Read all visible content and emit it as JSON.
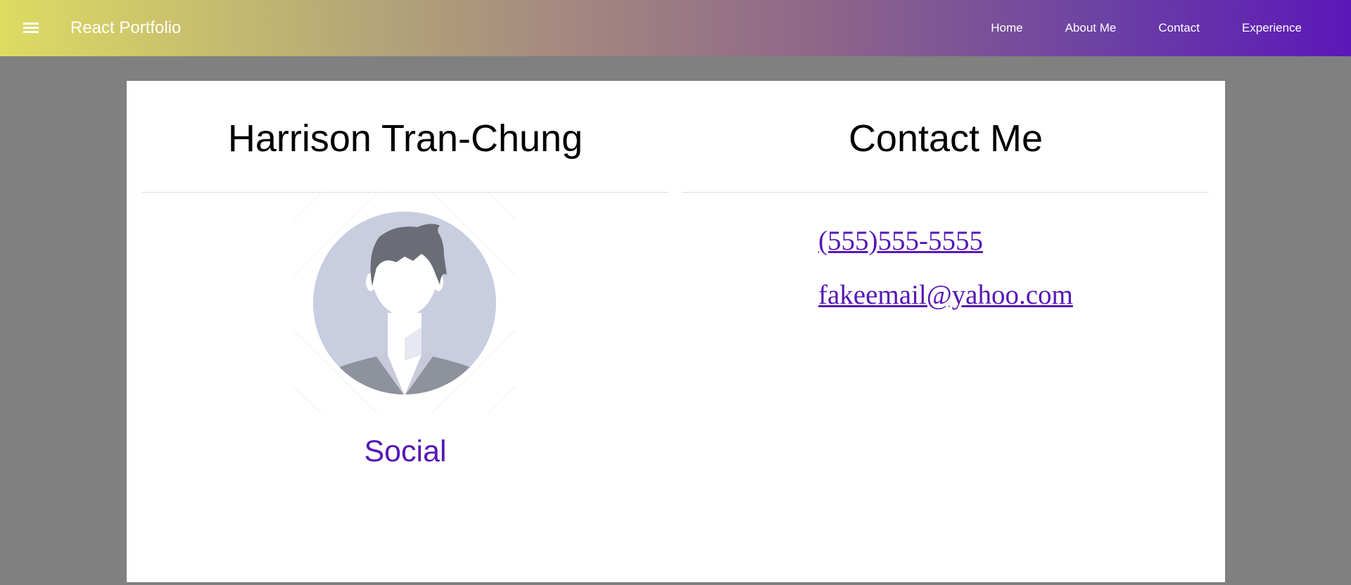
{
  "header": {
    "menu_icon": "hamburger-menu-icon",
    "brand": "React Portfolio",
    "nav": [
      {
        "label": "Home"
      },
      {
        "label": "About Me"
      },
      {
        "label": "Contact"
      },
      {
        "label": "Experience"
      }
    ]
  },
  "profile": {
    "name": "Harrison Tran-Chung",
    "avatar_icon": "default-user-avatar",
    "social_label": "Social"
  },
  "contact": {
    "title": "Contact Me",
    "phone": "(555)555-5555",
    "email": "fakeemail@yahoo.com"
  },
  "colors": {
    "link": "#5617b6",
    "header_gradient_start": "#dedb62",
    "header_gradient_end": "#5b18b8",
    "page_background": "#808080"
  }
}
